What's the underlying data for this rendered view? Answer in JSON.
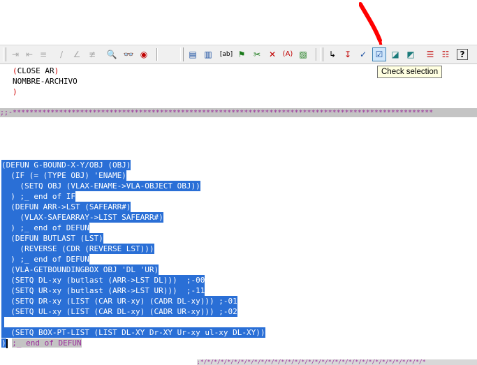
{
  "tooltip": {
    "text": "Check selection"
  },
  "toolbar": {
    "group1": [
      "indent-icon",
      "unindent-icon",
      "comment-icon",
      "slash-icon",
      "slash-left-icon",
      "uncomment-icon",
      "find-icon",
      "watch-icon",
      "breakpoint-icon"
    ],
    "group2": [
      "load-selection-icon",
      "load-file-icon",
      "text-box-icon",
      "format-icon",
      "apropos-icon",
      "inspect-icon",
      "atom-icon",
      "chart-icon"
    ],
    "group3": [
      "check-text-icon",
      "check-red-icon",
      "check-blue-icon",
      "check-selection-icon",
      "check-doc-icon",
      "check-doc2-icon",
      "list-icon",
      "list2-icon",
      "help-icon"
    ]
  },
  "code": {
    "line1_open": "(",
    "line1_kw": "CLOSE AR",
    "line1_close": ")",
    "line2": "NOMBRE-ARCHIVO",
    "line3": ")",
    "separator": ";;-****************************************************************************************************",
    "selected_lines": [
      "(DEFUN G-BOUND-X-Y/OBJ (OBJ)",
      "  (IF (= (TYPE OBJ) 'ENAME)",
      "    (SETQ OBJ (VLAX-ENAME->VLA-OBJECT OBJ))",
      "  ) ;_ end of IF",
      "  (DEFUN ARR->LST (SAFEARR#)",
      "    (VLAX-SAFEARRAY->LIST SAFEARR#)",
      "  ) ;_ end of DEFUN",
      "  (DEFUN BUTLAST (LST)",
      "    (REVERSE (CDR (REVERSE LST)))",
      "  ) ;_ end of DEFUN",
      "  (VLA-GETBOUNDINGBOX OBJ 'DL 'UR)",
      "  (SETQ DL-xy (butlast (ARR->LST DL)))  ;-00",
      "  (SETQ UR-xy (butlast (ARR->LST UR)))  ;-11",
      "  (SETQ DR-xy (LIST (CAR UR-xy) (CADR DL-xy))) ;-01",
      "  (SETQ UL-xy (LIST (CAR DL-xy) (CADR UR-xy))) ;-02",
      "",
      "  (SETQ BOX-PT-LIST (LIST DL-XY Dr-XY Ur-xy ul-xy DL-XY))"
    ],
    "last_line_paren": ")",
    "last_line_comment": ";_ end of DEFUN",
    "bottom_comment": ";*/*/*/*/*/*/*/*/*/*/*/*/*/*/*/*/*/*/*/*/*/*/*/*/*/*/*/*/*/*/*/*/*/*"
  }
}
